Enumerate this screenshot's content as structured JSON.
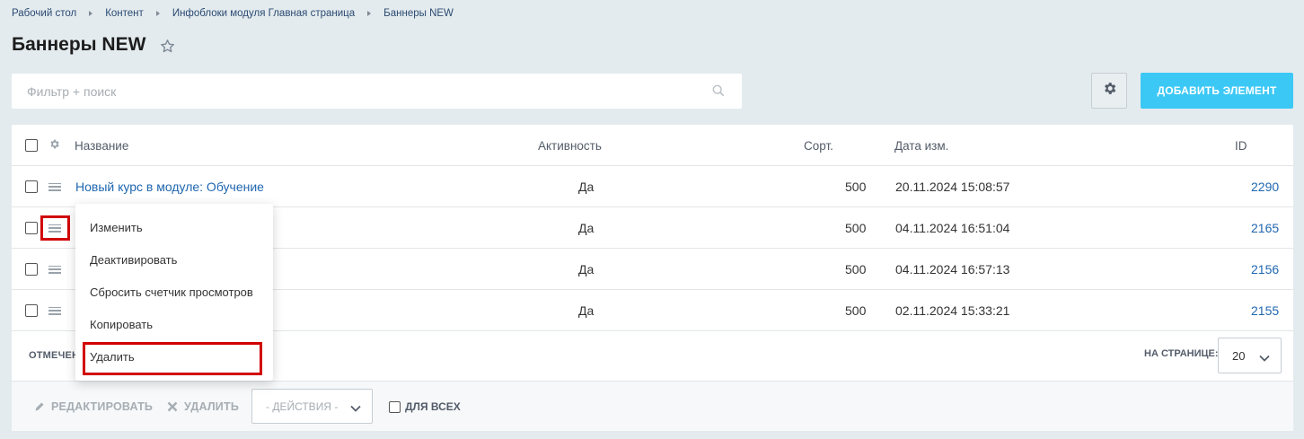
{
  "breadcrumb": [
    "Рабочий стол",
    "Контент",
    "Инфоблоки модуля Главная страница",
    "Баннеры NEW"
  ],
  "page_title": "Баннеры NEW",
  "search": {
    "placeholder": "Фильтр + поиск"
  },
  "toolbar": {
    "add_label": "ДОБАВИТЬ ЭЛЕМЕНТ"
  },
  "table": {
    "headers": {
      "name": "Название",
      "active": "Активность",
      "sort": "Сорт.",
      "date": "Дата изм.",
      "id": "ID"
    },
    "rows": [
      {
        "name": "Новый курс в модуле: Обучение",
        "active": "Да",
        "sort": "500",
        "date": "20.11.2024 15:08:57",
        "id": "2290"
      },
      {
        "name": "",
        "active": "Да",
        "sort": "500",
        "date": "04.11.2024 16:51:04",
        "id": "2165"
      },
      {
        "name": "",
        "active": "Да",
        "sort": "500",
        "date": "04.11.2024 16:57:13",
        "id": "2156"
      },
      {
        "name": "",
        "active": "Да",
        "sort": "500",
        "date": "02.11.2024 15:33:21",
        "id": "2155"
      }
    ]
  },
  "footer": {
    "selected_label": "ОТМЕЧЕН",
    "per_page_label": "НА СТРАНИЦЕ:",
    "per_page_value": "20"
  },
  "actions": {
    "edit": "РЕДАКТИРОВАТЬ",
    "delete": "УДАЛИТЬ",
    "select": "- ДЕЙСТВИЯ -",
    "for_all": "ДЛЯ ВСЕХ"
  },
  "context_menu": {
    "items": [
      "Изменить",
      "Деактивировать",
      "Сбросить счетчик просмотров",
      "Копировать",
      "Удалить"
    ]
  },
  "colors": {
    "accent": "#3bc8f5",
    "link": "#2067b0",
    "highlight": "#d10000",
    "background": "#e4ebee"
  }
}
